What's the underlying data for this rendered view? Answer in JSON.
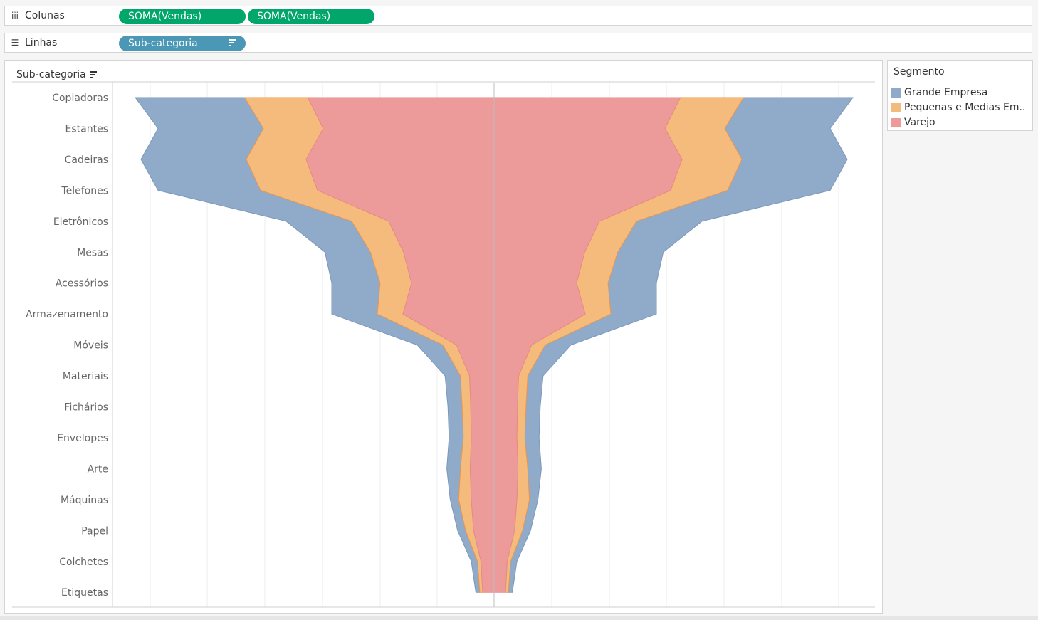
{
  "shelves": {
    "columns": {
      "label": "Colunas",
      "pills": [
        "SOMA(Vendas)",
        "SOMA(Vendas)"
      ]
    },
    "rows": {
      "label": "Linhas",
      "pill": "Sub-categoria"
    }
  },
  "colors": {
    "grande": "#8fabc9",
    "pequenas": "#f5bb7c",
    "varejo": "#ec9a9a",
    "pill_measure": "#00a66a",
    "pill_dimension": "#4b97b6"
  },
  "legend": {
    "title": "Segmento",
    "items": [
      {
        "label": "Grande Empresa",
        "color": "#8fabc9"
      },
      {
        "label": "Pequenas e Medias Em..",
        "color": "#f5bb7c"
      },
      {
        "label": "Varejo",
        "color": "#ec9a9a"
      }
    ]
  },
  "chart_data": {
    "type": "area",
    "orientation": "funnel-mirrored",
    "y_header": "Sub-categoria",
    "categories": [
      "Copiadoras",
      "Estantes",
      "Cadeiras",
      "Telefones",
      "Eletrônicos",
      "Mesas",
      "Acessórios",
      "Armazenamento",
      "Móveis",
      "Materiais",
      "Fichários",
      "Envelopes",
      "Arte",
      "Máquinas",
      "Papel",
      "Colchetes",
      "Etiquetas"
    ],
    "series": [
      {
        "name": "Varejo",
        "color": "#ec9a9a",
        "values": [
          327,
          300,
          330,
          310,
          185,
          159,
          145,
          160,
          66,
          43,
          41,
          40,
          42,
          40,
          36,
          23,
          20
        ]
      },
      {
        "name": "Pequenas e Medias Em..",
        "color": "#f5bb7c",
        "values": [
          111,
          105,
          105,
          100,
          65,
          58,
          55,
          45,
          24,
          16,
          15,
          14,
          17,
          22,
          14,
          6,
          5
        ]
      },
      {
        "name": "Grande Empresa",
        "color": "#8fabc9",
        "values": [
          192,
          185,
          185,
          180,
          115,
          80,
          85,
          80,
          45,
          27,
          25,
          25,
          24,
          15,
          14,
          11,
          7
        ]
      }
    ],
    "grid": true,
    "legend_position": "right"
  }
}
